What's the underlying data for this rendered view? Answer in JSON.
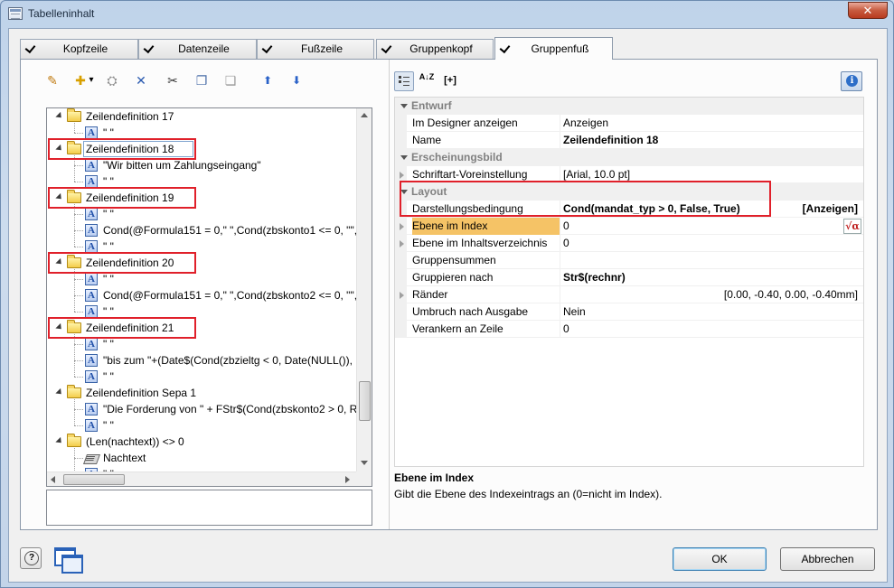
{
  "window": {
    "title": "Tabelleninhalt",
    "close_glyph": "✕"
  },
  "tabs": [
    {
      "label": "Kopfzeile",
      "checked": true
    },
    {
      "label": "Datenzeile",
      "checked": true
    },
    {
      "label": "Fußzeile",
      "checked": true
    },
    {
      "label": "Gruppenkopf",
      "checked": true
    },
    {
      "label": "Gruppenfuß",
      "checked": true,
      "active": true
    }
  ],
  "toolbar_left": {
    "icons": [
      "wand-icon",
      "new-icon",
      "properties-icon",
      "delete-icon",
      "cut-icon",
      "copy-icon",
      "paste-icon",
      "move-up-icon",
      "move-down-icon"
    ],
    "glyphs": [
      "✎",
      "✚",
      "⛭",
      "✕",
      "✂",
      "❐",
      "❏",
      "⬆",
      "⬇"
    ],
    "dropdown_glyph": "▾"
  },
  "tree": {
    "rows": [
      {
        "type": "folder",
        "text": "Zeilendefinition 17"
      },
      {
        "type": "text",
        "text": "\" \""
      },
      {
        "type": "folder",
        "text": "Zeilendefinition 18"
      },
      {
        "type": "text",
        "text": "\"Wir bitten um Zahlungseingang\""
      },
      {
        "type": "text",
        "text": "\" \""
      },
      {
        "type": "folder",
        "text": "Zeilendefinition 19"
      },
      {
        "type": "text",
        "text": "\" \""
      },
      {
        "type": "text",
        "text": "Cond(@Formula151 = 0,\" \",Cond(zbskonto1 <= 0, \"\","
      },
      {
        "type": "text",
        "text": "\" \""
      },
      {
        "type": "folder",
        "text": "Zeilendefinition 20"
      },
      {
        "type": "text",
        "text": "\" \""
      },
      {
        "type": "text",
        "text": "Cond(@Formula151 = 0,\" \",Cond(zbskonto2 <= 0, \"\","
      },
      {
        "type": "text",
        "text": "\" \""
      },
      {
        "type": "folder",
        "text": "Zeilendefinition 21"
      },
      {
        "type": "text",
        "text": "\" \""
      },
      {
        "type": "text",
        "text": "\"bis zum  \"+(Date$(Cond(zbzieltg < 0, Date(NULL()),"
      },
      {
        "type": "text",
        "text": "\" \""
      },
      {
        "type": "folder",
        "text": "Zeilendefinition Sepa 1"
      },
      {
        "type": "text",
        "text": "\"Die Forderung von \" + FStr$(Cond(zbskonto2 > 0, Ro"
      },
      {
        "type": "text",
        "text": "\" \""
      },
      {
        "type": "folder",
        "text": "(Len(nachtext)) <> 0"
      },
      {
        "type": "note",
        "text": "Nachtext"
      },
      {
        "type": "text",
        "text": "\" \""
      }
    ],
    "a_glyph": "A"
  },
  "toolbar_right": {
    "sort_glyph": "A↓Z",
    "expand_glyph": "[+]"
  },
  "properties": {
    "categories": {
      "entwurf": "Entwurf",
      "erscheinungsbild": "Erscheinungsbild",
      "layout": "Layout"
    },
    "entwurf_rows": [
      {
        "name": "Im Designer anzeigen",
        "value": "Anzeigen",
        "bold": false
      },
      {
        "name": "Name",
        "value": "Zeilendefinition 18",
        "bold": true
      }
    ],
    "erscheinungsbild_rows": [
      {
        "name": "Schriftart-Voreinstellung",
        "value": "[Arial, 10.0 pt]",
        "bold": false,
        "expandable": true
      }
    ],
    "layout_rows": [
      {
        "name": "Darstellungsbedingung",
        "value": "Cond(mandat_typ > 0, False, True)",
        "right": "[Anzeigen]",
        "bold": true
      },
      {
        "name": "Ebene im Index",
        "value": "0",
        "bold": false,
        "expandable": true,
        "selected": true
      },
      {
        "name": "Ebene im Inhaltsverzeichnis",
        "value": "0",
        "bold": false,
        "expandable": true
      },
      {
        "name": "Gruppensummen",
        "value": "",
        "bold": false
      },
      {
        "name": "Gruppieren nach",
        "value": "Str$(rechnr)",
        "bold": true
      },
      {
        "name": "Ränder",
        "value": "",
        "right": "[0.00, -0.40, 0.00, -0.40mm]",
        "bold": false,
        "expandable": true
      },
      {
        "name": "Umbruch nach Ausgabe",
        "value": "Nein",
        "bold": false
      },
      {
        "name": "Verankern an Zeile",
        "value": "0",
        "bold": false
      }
    ],
    "formula_glyph": "√α"
  },
  "description": {
    "title": "Ebene im Index",
    "text": "Gibt die Ebene des Indexeintrags an (0=nicht im Index)."
  },
  "buttons": {
    "ok": "OK",
    "cancel": "Abbrechen"
  },
  "colors": {
    "highlight": "#e0202a",
    "selected_row": "#f5c366"
  }
}
